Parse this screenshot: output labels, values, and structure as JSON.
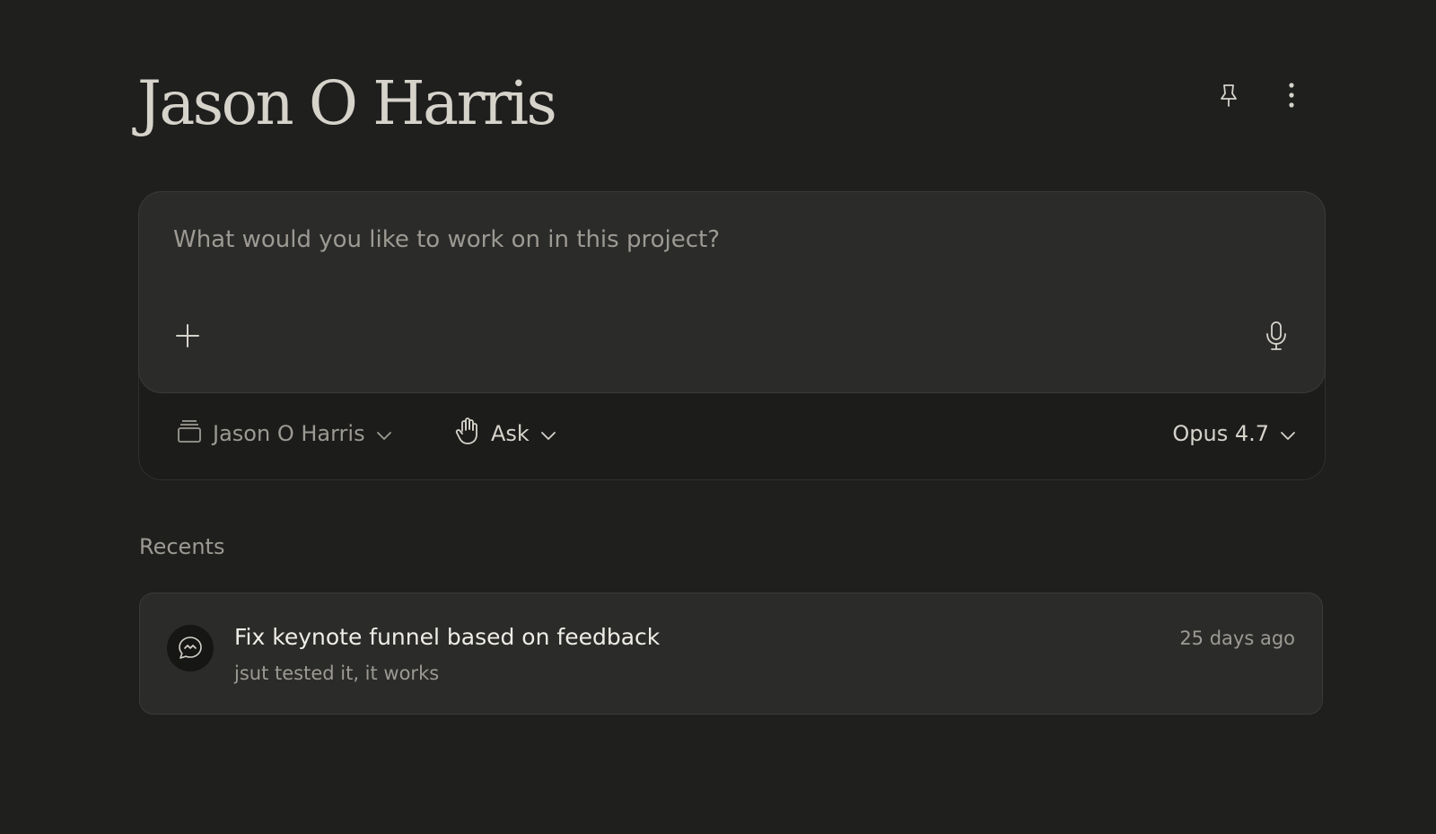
{
  "project": {
    "title": "Jason O Harris"
  },
  "header": {
    "icons": [
      "pin-icon",
      "more-vertical-icon"
    ]
  },
  "composer": {
    "placeholder": "What would you like to work on in this project?",
    "value": "",
    "add_icon": "plus-icon",
    "mic_icon": "microphone-icon"
  },
  "toolbar": {
    "project_label": "Jason O Harris",
    "project_icon": "project-box-icon",
    "mode_label": "Ask",
    "mode_icon": "hand-icon",
    "model_label": "Opus 4.7"
  },
  "recents": {
    "label": "Recents",
    "items": [
      {
        "title": "Fix keynote funnel based on feedback",
        "subtitle": "jsut tested it, it works",
        "time": "25 days ago",
        "icon": "chat-bubble-icon"
      }
    ]
  },
  "colors": {
    "background": "#1f1f1e",
    "card": "#2b2b2a",
    "text_primary": "#e8e6df",
    "text_muted": "#9c9a92"
  }
}
